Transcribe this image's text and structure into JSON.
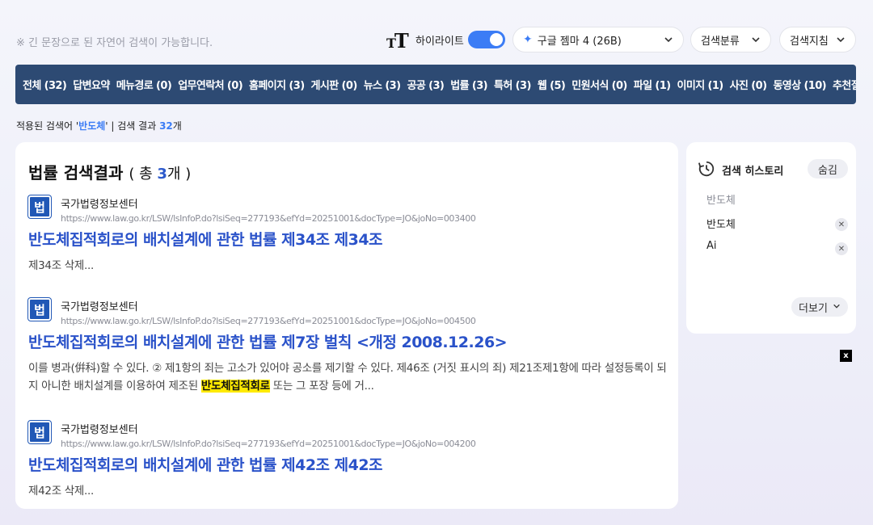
{
  "header": {
    "hint": "※ 긴 문장으로 된 자연어 검색이 가능합니다.",
    "tt_icon": "text-size-icon",
    "highlight_label": "하이라이트",
    "highlight_on": true,
    "model_select": "구글 젬마 4 (26B)",
    "category_select": "검색분류",
    "guide_select": "검색지침",
    "accent_color": "#3b7cf5"
  },
  "nav": {
    "background": "#2d4a73",
    "items": [
      "전체 (32)",
      "답변요약",
      "메뉴경로 (0)",
      "업무연락처 (0)",
      "홈페이지 (3)",
      "게시판 (0)",
      "뉴스 (3)",
      "공공 (3)",
      "법률 (3)",
      "특허 (3)",
      "웹 (5)",
      "민원서식 (0)",
      "파일 (1)",
      "이미지 (1)",
      "사진 (0)",
      "동영상 (10)",
      "추천질문"
    ]
  },
  "applied": {
    "prefix": "적용된 검색어 '",
    "keyword": "반도체",
    "middle": "' | 검색 결과 ",
    "count": "32",
    "suffix": "개"
  },
  "results": {
    "title": "법률 검색결과",
    "total_prefix": "( 총 ",
    "total": "3",
    "total_suffix": "개 )",
    "items": [
      {
        "logo": "법",
        "source": "국가법령정보센터",
        "url": "https://www.law.go.kr/LSW/lsInfoP.do?lsiSeq=277193&efYd=20251001&docType=JO&joNo=003400",
        "title": "반도체집적회로의 배치설계에 관한 법률 제34조 제34조",
        "snippet": "제34조 삭제..."
      },
      {
        "logo": "법",
        "source": "국가법령정보센터",
        "url": "https://www.law.go.kr/LSW/lsInfoP.do?lsiSeq=277193&efYd=20251001&docType=JO&joNo=004500",
        "title": "반도체집적회로의 배치설계에 관한 법률 제7장 벌칙 <개정 2008.12.26>",
        "snippet_before": "이를 병과(倂科)할 수 있다. ② 제1항의 죄는 고소가 있어야 공소를 제기할 수 있다. 제46조 (거짓 표시의 죄) 제21조제1항에 따라 설정등록이 되지 아니한 배치설계를 이용하여 제조된 ",
        "snippet_mark": "반도체집적회로",
        "snippet_after": " 또는 그 포장 등에 거..."
      },
      {
        "logo": "법",
        "source": "국가법령정보센터",
        "url": "https://www.law.go.kr/LSW/lsInfoP.do?lsiSeq=277193&efYd=20251001&docType=JO&joNo=004200",
        "title": "반도체집적회로의 배치설계에 관한 법률 제42조 제42조",
        "snippet": "제42조 삭제..."
      }
    ]
  },
  "history": {
    "title": "검색 히스토리",
    "hide_label": "숨김",
    "entries": [
      "반도체",
      "반도체",
      "Ai"
    ],
    "more_label": "더보기"
  },
  "overlay": {
    "close_label": "x"
  }
}
